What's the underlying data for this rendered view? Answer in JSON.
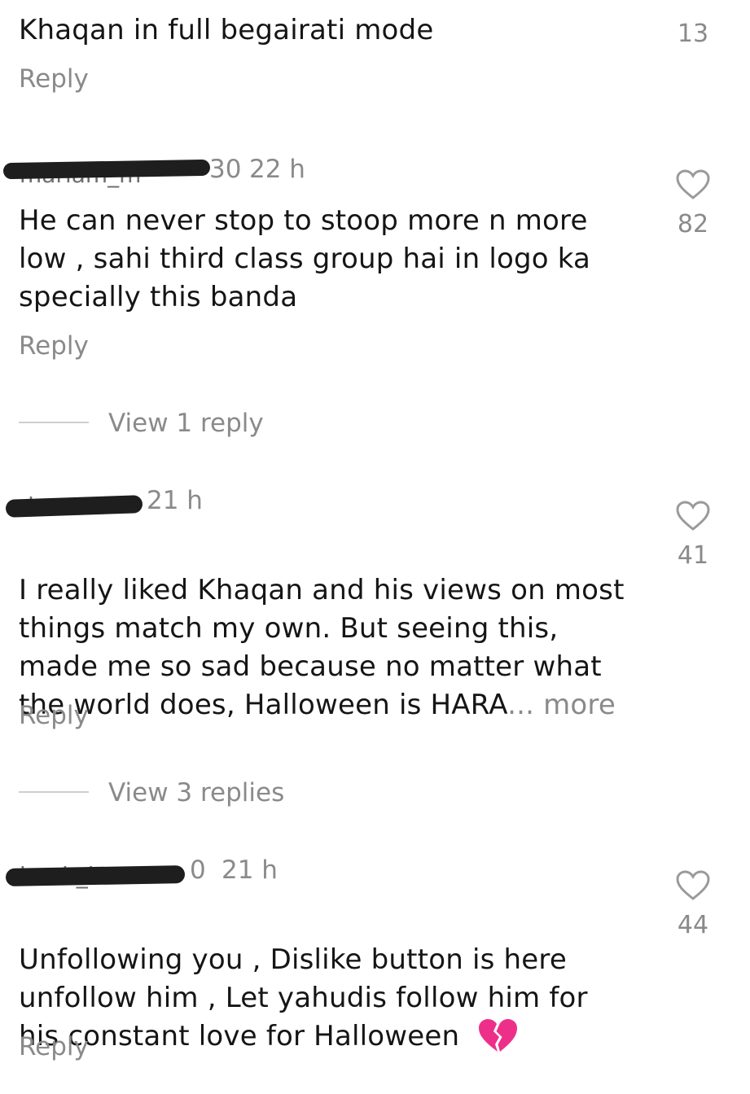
{
  "comments": [
    {
      "text": "Khaqan in full begairati mode",
      "likes": "13",
      "reply_label": "Reply"
    },
    {
      "username_visible": "30",
      "time": "22 h",
      "text": "He can never stop to stoop more n more\nlow , sahi third class group hai in logo ka\nspecially this banda",
      "likes": "82",
      "reply_label": "Reply",
      "view_replies": "View 1 reply"
    },
    {
      "time": "21 h",
      "text": "I really liked Khaqan and his views on most\nthings match my own. But seeing this,\nmade me so sad because no matter what\nthe world does, Halloween is HARA",
      "more_label": "... more",
      "likes": "41",
      "reply_label": "Reply",
      "view_replies": "View 3 replies"
    },
    {
      "username_visible": "0",
      "time": "21 h",
      "text": "Unfollowing you , Dislike button is here\nunfollow him , Let yahudis follow him for\nhis constant love for Halloween",
      "emoji": "💔",
      "likes": "44",
      "reply_label": "Reply"
    }
  ]
}
